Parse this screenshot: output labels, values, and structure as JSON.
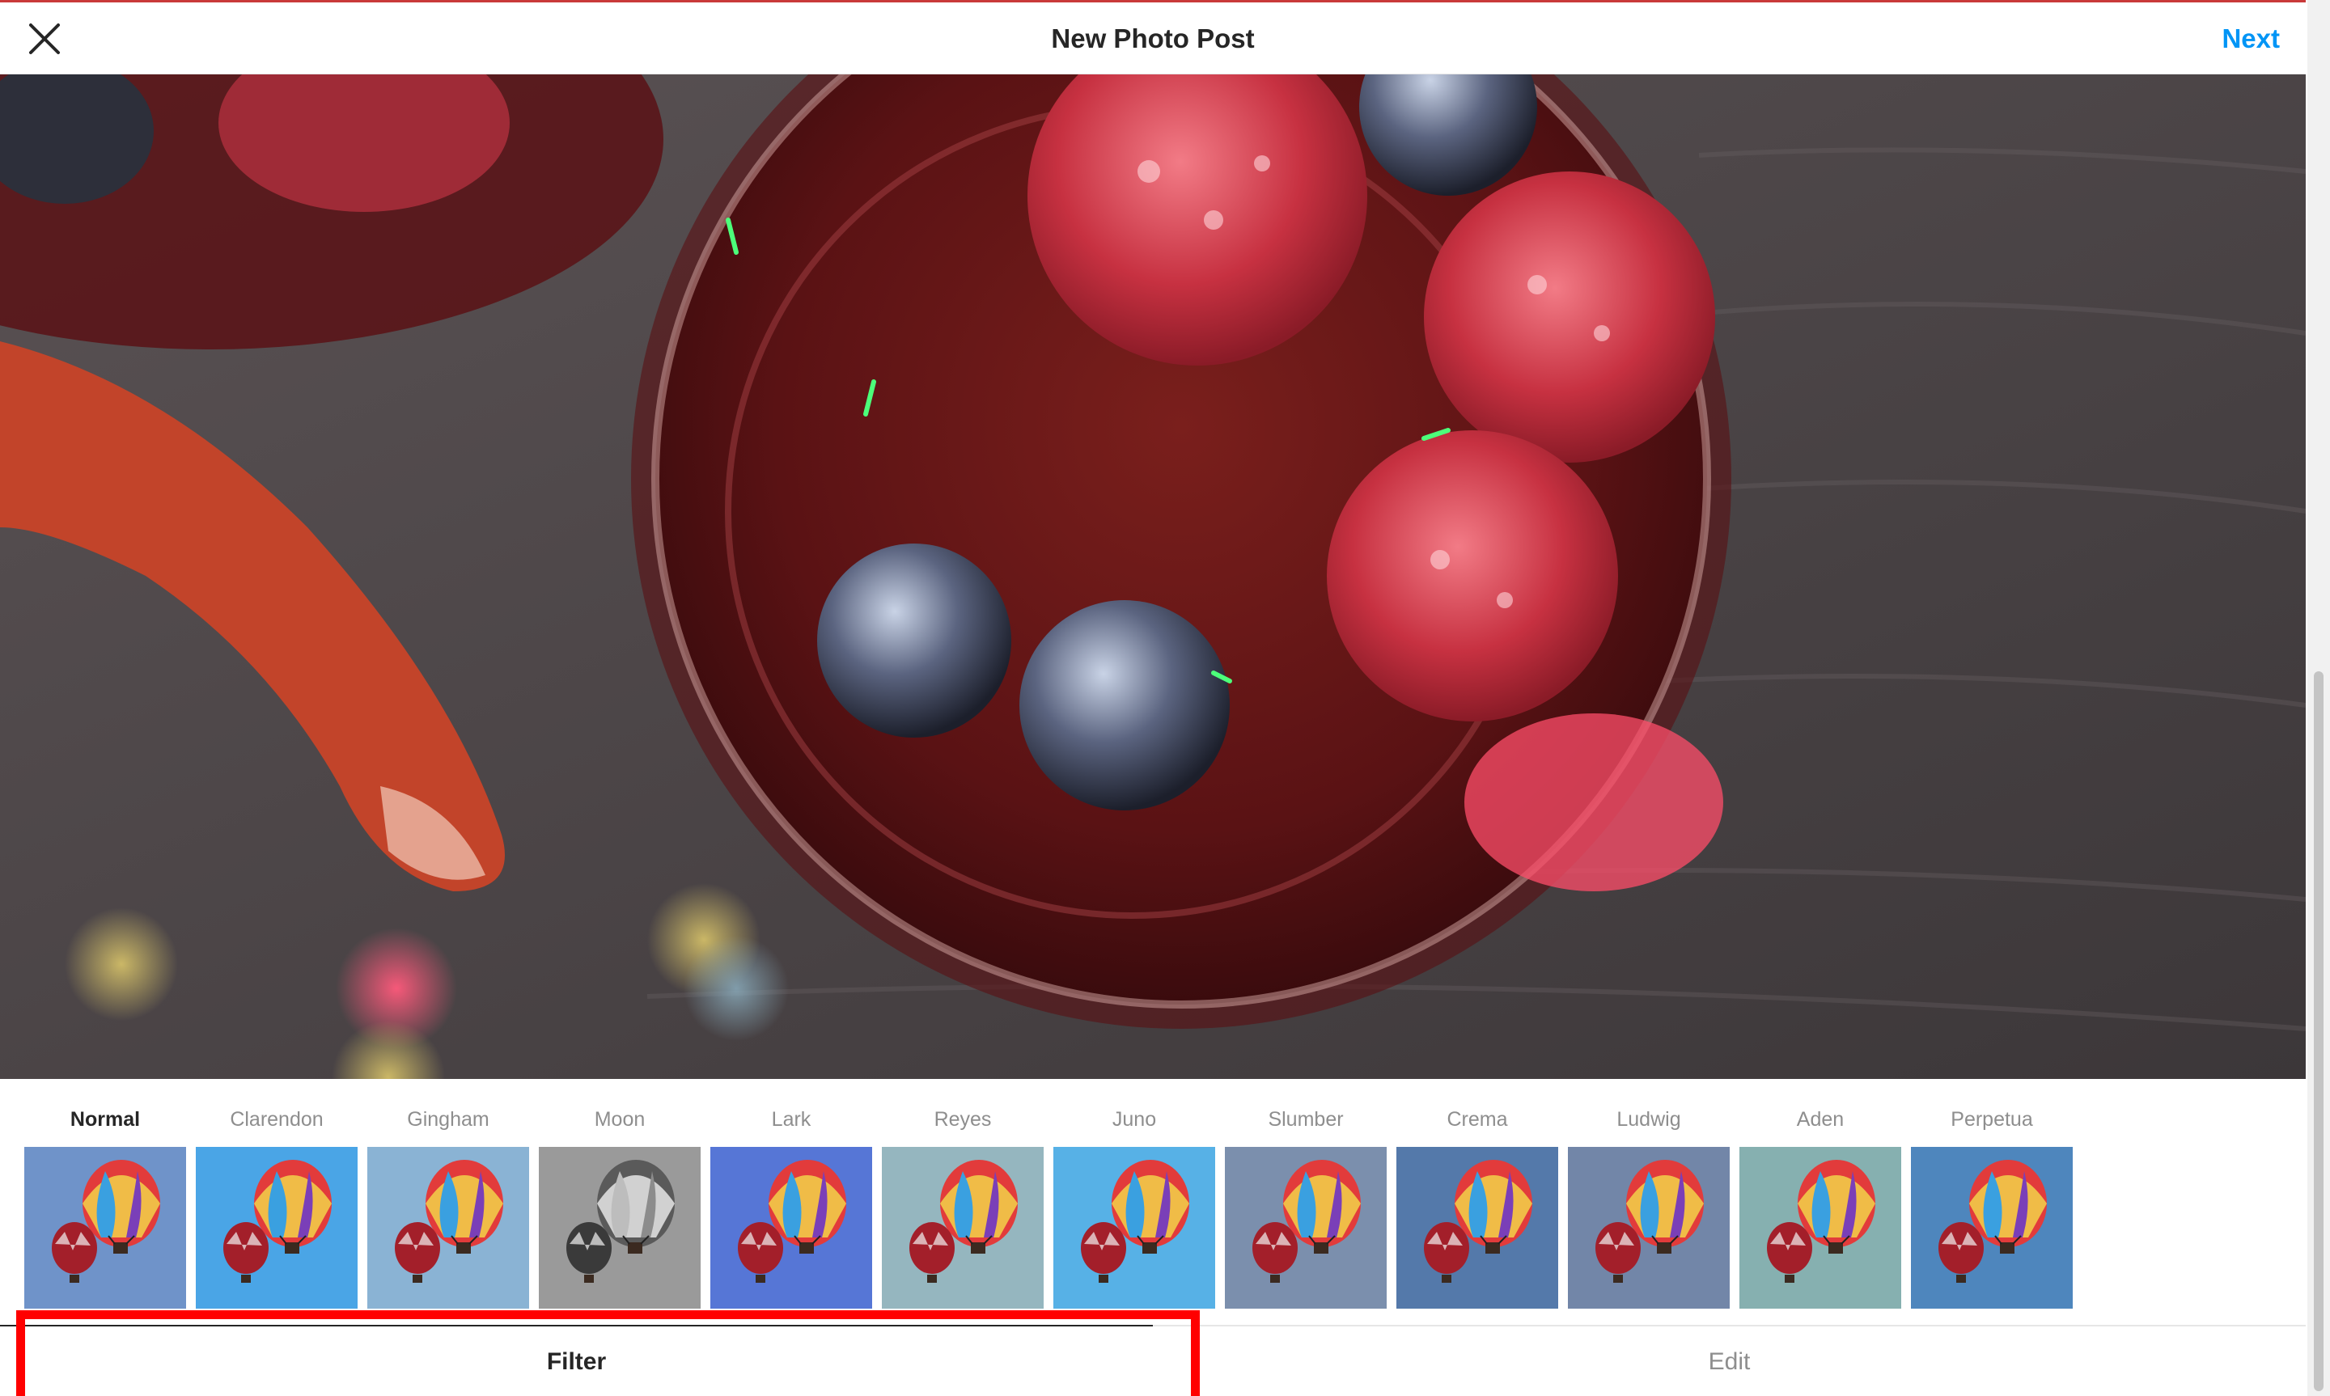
{
  "header": {
    "title": "New Photo Post",
    "next_label": "Next",
    "close_icon": "close-icon"
  },
  "filters": [
    {
      "label": "Normal",
      "selected": true
    },
    {
      "label": "Clarendon",
      "selected": false
    },
    {
      "label": "Gingham",
      "selected": false
    },
    {
      "label": "Moon",
      "selected": false
    },
    {
      "label": "Lark",
      "selected": false
    },
    {
      "label": "Reyes",
      "selected": false
    },
    {
      "label": "Juno",
      "selected": false
    },
    {
      "label": "Slumber",
      "selected": false
    },
    {
      "label": "Crema",
      "selected": false
    },
    {
      "label": "Ludwig",
      "selected": false
    },
    {
      "label": "Aden",
      "selected": false
    },
    {
      "label": "Perpetua",
      "selected": false
    }
  ],
  "tabs": {
    "filter_label": "Filter",
    "edit_label": "Edit",
    "active": "Filter"
  },
  "colors": {
    "accent": "#0095f6",
    "highlight": "#ff0000",
    "text_primary": "#262626",
    "text_secondary": "#8e8e8e"
  }
}
